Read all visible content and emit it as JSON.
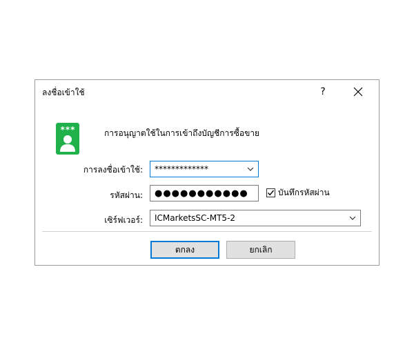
{
  "dialog": {
    "title": "ลงชื่อเข้าใช้",
    "help": "?",
    "description": "การอนุญาตใช้ในการเข้าถึงบัญชีการซื้อขาย"
  },
  "icon": {
    "stars": "***",
    "semantic": "user-login-icon",
    "color": "#21b14a"
  },
  "form": {
    "login_label": "การลงชื่อเข้าใช้:",
    "login_value": "*************",
    "password_label": "รหัสผ่าน:",
    "password_value": "●●●●●●●●●●●",
    "save_password_label": "บันทึกรหัสผ่าน",
    "save_password_checked": true,
    "server_label": "เซิร์ฟเวอร์:",
    "server_value": "ICMarketsSC-MT5-2"
  },
  "buttons": {
    "ok": "ตกลง",
    "cancel": "ยกเลิก"
  },
  "colors": {
    "accent": "#0078d7",
    "button_bg": "#e1e1e1"
  }
}
